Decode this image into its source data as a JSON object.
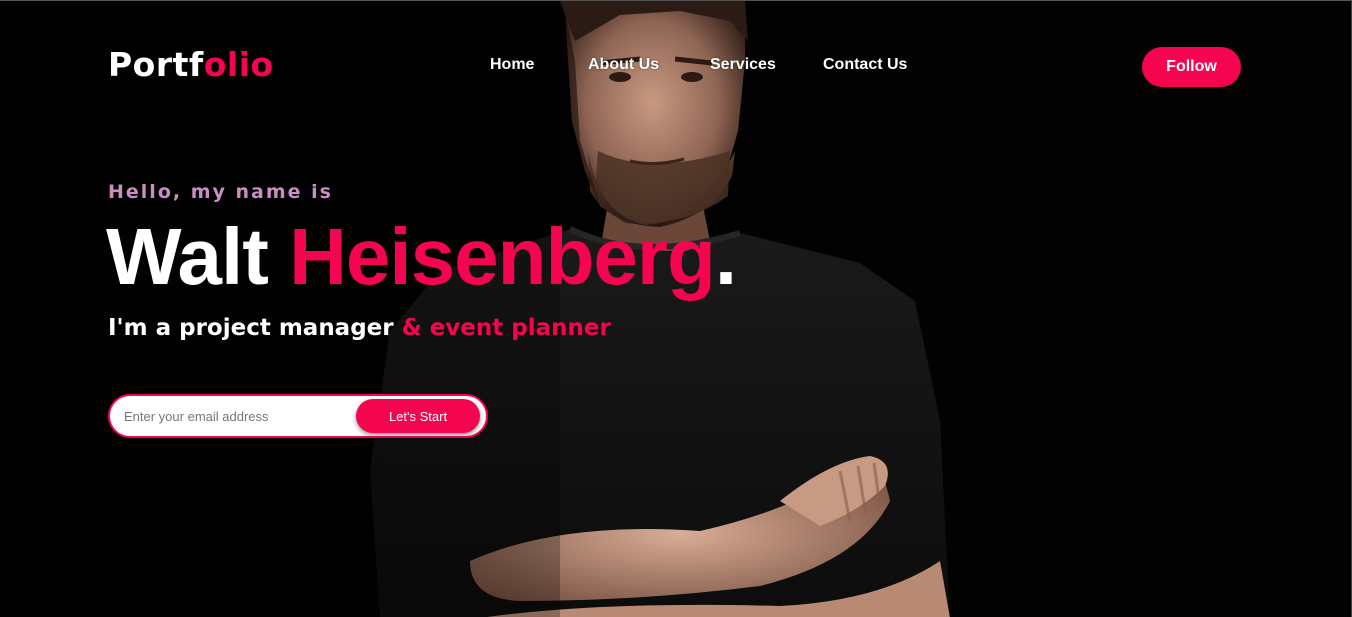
{
  "colors": {
    "accent": "#f5054f",
    "greeting": "#c98ec2",
    "background": "#020202",
    "text": "#ffffff"
  },
  "logo": {
    "part1": "Portf",
    "part2": "olio"
  },
  "nav": {
    "links": [
      "Home",
      "About Us",
      "Services",
      "Contact Us"
    ],
    "follow_label": "Follow"
  },
  "hero": {
    "greeting": "Hello, my name is",
    "first_name": "Walt",
    "last_name": "Heisenberg",
    "punctuation": ".",
    "tagline_main": "I'm a project manager",
    "tagline_accent": "& event planner"
  },
  "form": {
    "email_placeholder": "Enter your email address",
    "email_value": "",
    "submit_label": "Let's Start"
  }
}
